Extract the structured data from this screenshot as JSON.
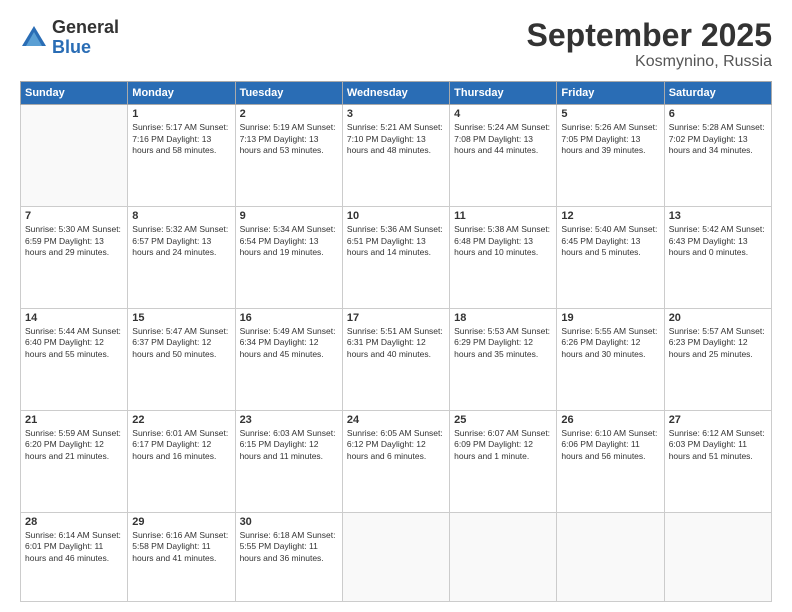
{
  "logo": {
    "general": "General",
    "blue": "Blue"
  },
  "title": "September 2025",
  "location": "Kosmynino, Russia",
  "days_of_week": [
    "Sunday",
    "Monday",
    "Tuesday",
    "Wednesday",
    "Thursday",
    "Friday",
    "Saturday"
  ],
  "weeks": [
    [
      {
        "day": "",
        "info": ""
      },
      {
        "day": "1",
        "info": "Sunrise: 5:17 AM\nSunset: 7:16 PM\nDaylight: 13 hours\nand 58 minutes."
      },
      {
        "day": "2",
        "info": "Sunrise: 5:19 AM\nSunset: 7:13 PM\nDaylight: 13 hours\nand 53 minutes."
      },
      {
        "day": "3",
        "info": "Sunrise: 5:21 AM\nSunset: 7:10 PM\nDaylight: 13 hours\nand 48 minutes."
      },
      {
        "day": "4",
        "info": "Sunrise: 5:24 AM\nSunset: 7:08 PM\nDaylight: 13 hours\nand 44 minutes."
      },
      {
        "day": "5",
        "info": "Sunrise: 5:26 AM\nSunset: 7:05 PM\nDaylight: 13 hours\nand 39 minutes."
      },
      {
        "day": "6",
        "info": "Sunrise: 5:28 AM\nSunset: 7:02 PM\nDaylight: 13 hours\nand 34 minutes."
      }
    ],
    [
      {
        "day": "7",
        "info": "Sunrise: 5:30 AM\nSunset: 6:59 PM\nDaylight: 13 hours\nand 29 minutes."
      },
      {
        "day": "8",
        "info": "Sunrise: 5:32 AM\nSunset: 6:57 PM\nDaylight: 13 hours\nand 24 minutes."
      },
      {
        "day": "9",
        "info": "Sunrise: 5:34 AM\nSunset: 6:54 PM\nDaylight: 13 hours\nand 19 minutes."
      },
      {
        "day": "10",
        "info": "Sunrise: 5:36 AM\nSunset: 6:51 PM\nDaylight: 13 hours\nand 14 minutes."
      },
      {
        "day": "11",
        "info": "Sunrise: 5:38 AM\nSunset: 6:48 PM\nDaylight: 13 hours\nand 10 minutes."
      },
      {
        "day": "12",
        "info": "Sunrise: 5:40 AM\nSunset: 6:45 PM\nDaylight: 13 hours\nand 5 minutes."
      },
      {
        "day": "13",
        "info": "Sunrise: 5:42 AM\nSunset: 6:43 PM\nDaylight: 13 hours\nand 0 minutes."
      }
    ],
    [
      {
        "day": "14",
        "info": "Sunrise: 5:44 AM\nSunset: 6:40 PM\nDaylight: 12 hours\nand 55 minutes."
      },
      {
        "day": "15",
        "info": "Sunrise: 5:47 AM\nSunset: 6:37 PM\nDaylight: 12 hours\nand 50 minutes."
      },
      {
        "day": "16",
        "info": "Sunrise: 5:49 AM\nSunset: 6:34 PM\nDaylight: 12 hours\nand 45 minutes."
      },
      {
        "day": "17",
        "info": "Sunrise: 5:51 AM\nSunset: 6:31 PM\nDaylight: 12 hours\nand 40 minutes."
      },
      {
        "day": "18",
        "info": "Sunrise: 5:53 AM\nSunset: 6:29 PM\nDaylight: 12 hours\nand 35 minutes."
      },
      {
        "day": "19",
        "info": "Sunrise: 5:55 AM\nSunset: 6:26 PM\nDaylight: 12 hours\nand 30 minutes."
      },
      {
        "day": "20",
        "info": "Sunrise: 5:57 AM\nSunset: 6:23 PM\nDaylight: 12 hours\nand 25 minutes."
      }
    ],
    [
      {
        "day": "21",
        "info": "Sunrise: 5:59 AM\nSunset: 6:20 PM\nDaylight: 12 hours\nand 21 minutes."
      },
      {
        "day": "22",
        "info": "Sunrise: 6:01 AM\nSunset: 6:17 PM\nDaylight: 12 hours\nand 16 minutes."
      },
      {
        "day": "23",
        "info": "Sunrise: 6:03 AM\nSunset: 6:15 PM\nDaylight: 12 hours\nand 11 minutes."
      },
      {
        "day": "24",
        "info": "Sunrise: 6:05 AM\nSunset: 6:12 PM\nDaylight: 12 hours\nand 6 minutes."
      },
      {
        "day": "25",
        "info": "Sunrise: 6:07 AM\nSunset: 6:09 PM\nDaylight: 12 hours\nand 1 minute."
      },
      {
        "day": "26",
        "info": "Sunrise: 6:10 AM\nSunset: 6:06 PM\nDaylight: 11 hours\nand 56 minutes."
      },
      {
        "day": "27",
        "info": "Sunrise: 6:12 AM\nSunset: 6:03 PM\nDaylight: 11 hours\nand 51 minutes."
      }
    ],
    [
      {
        "day": "28",
        "info": "Sunrise: 6:14 AM\nSunset: 6:01 PM\nDaylight: 11 hours\nand 46 minutes."
      },
      {
        "day": "29",
        "info": "Sunrise: 6:16 AM\nSunset: 5:58 PM\nDaylight: 11 hours\nand 41 minutes."
      },
      {
        "day": "30",
        "info": "Sunrise: 6:18 AM\nSunset: 5:55 PM\nDaylight: 11 hours\nand 36 minutes."
      },
      {
        "day": "",
        "info": ""
      },
      {
        "day": "",
        "info": ""
      },
      {
        "day": "",
        "info": ""
      },
      {
        "day": "",
        "info": ""
      }
    ]
  ]
}
